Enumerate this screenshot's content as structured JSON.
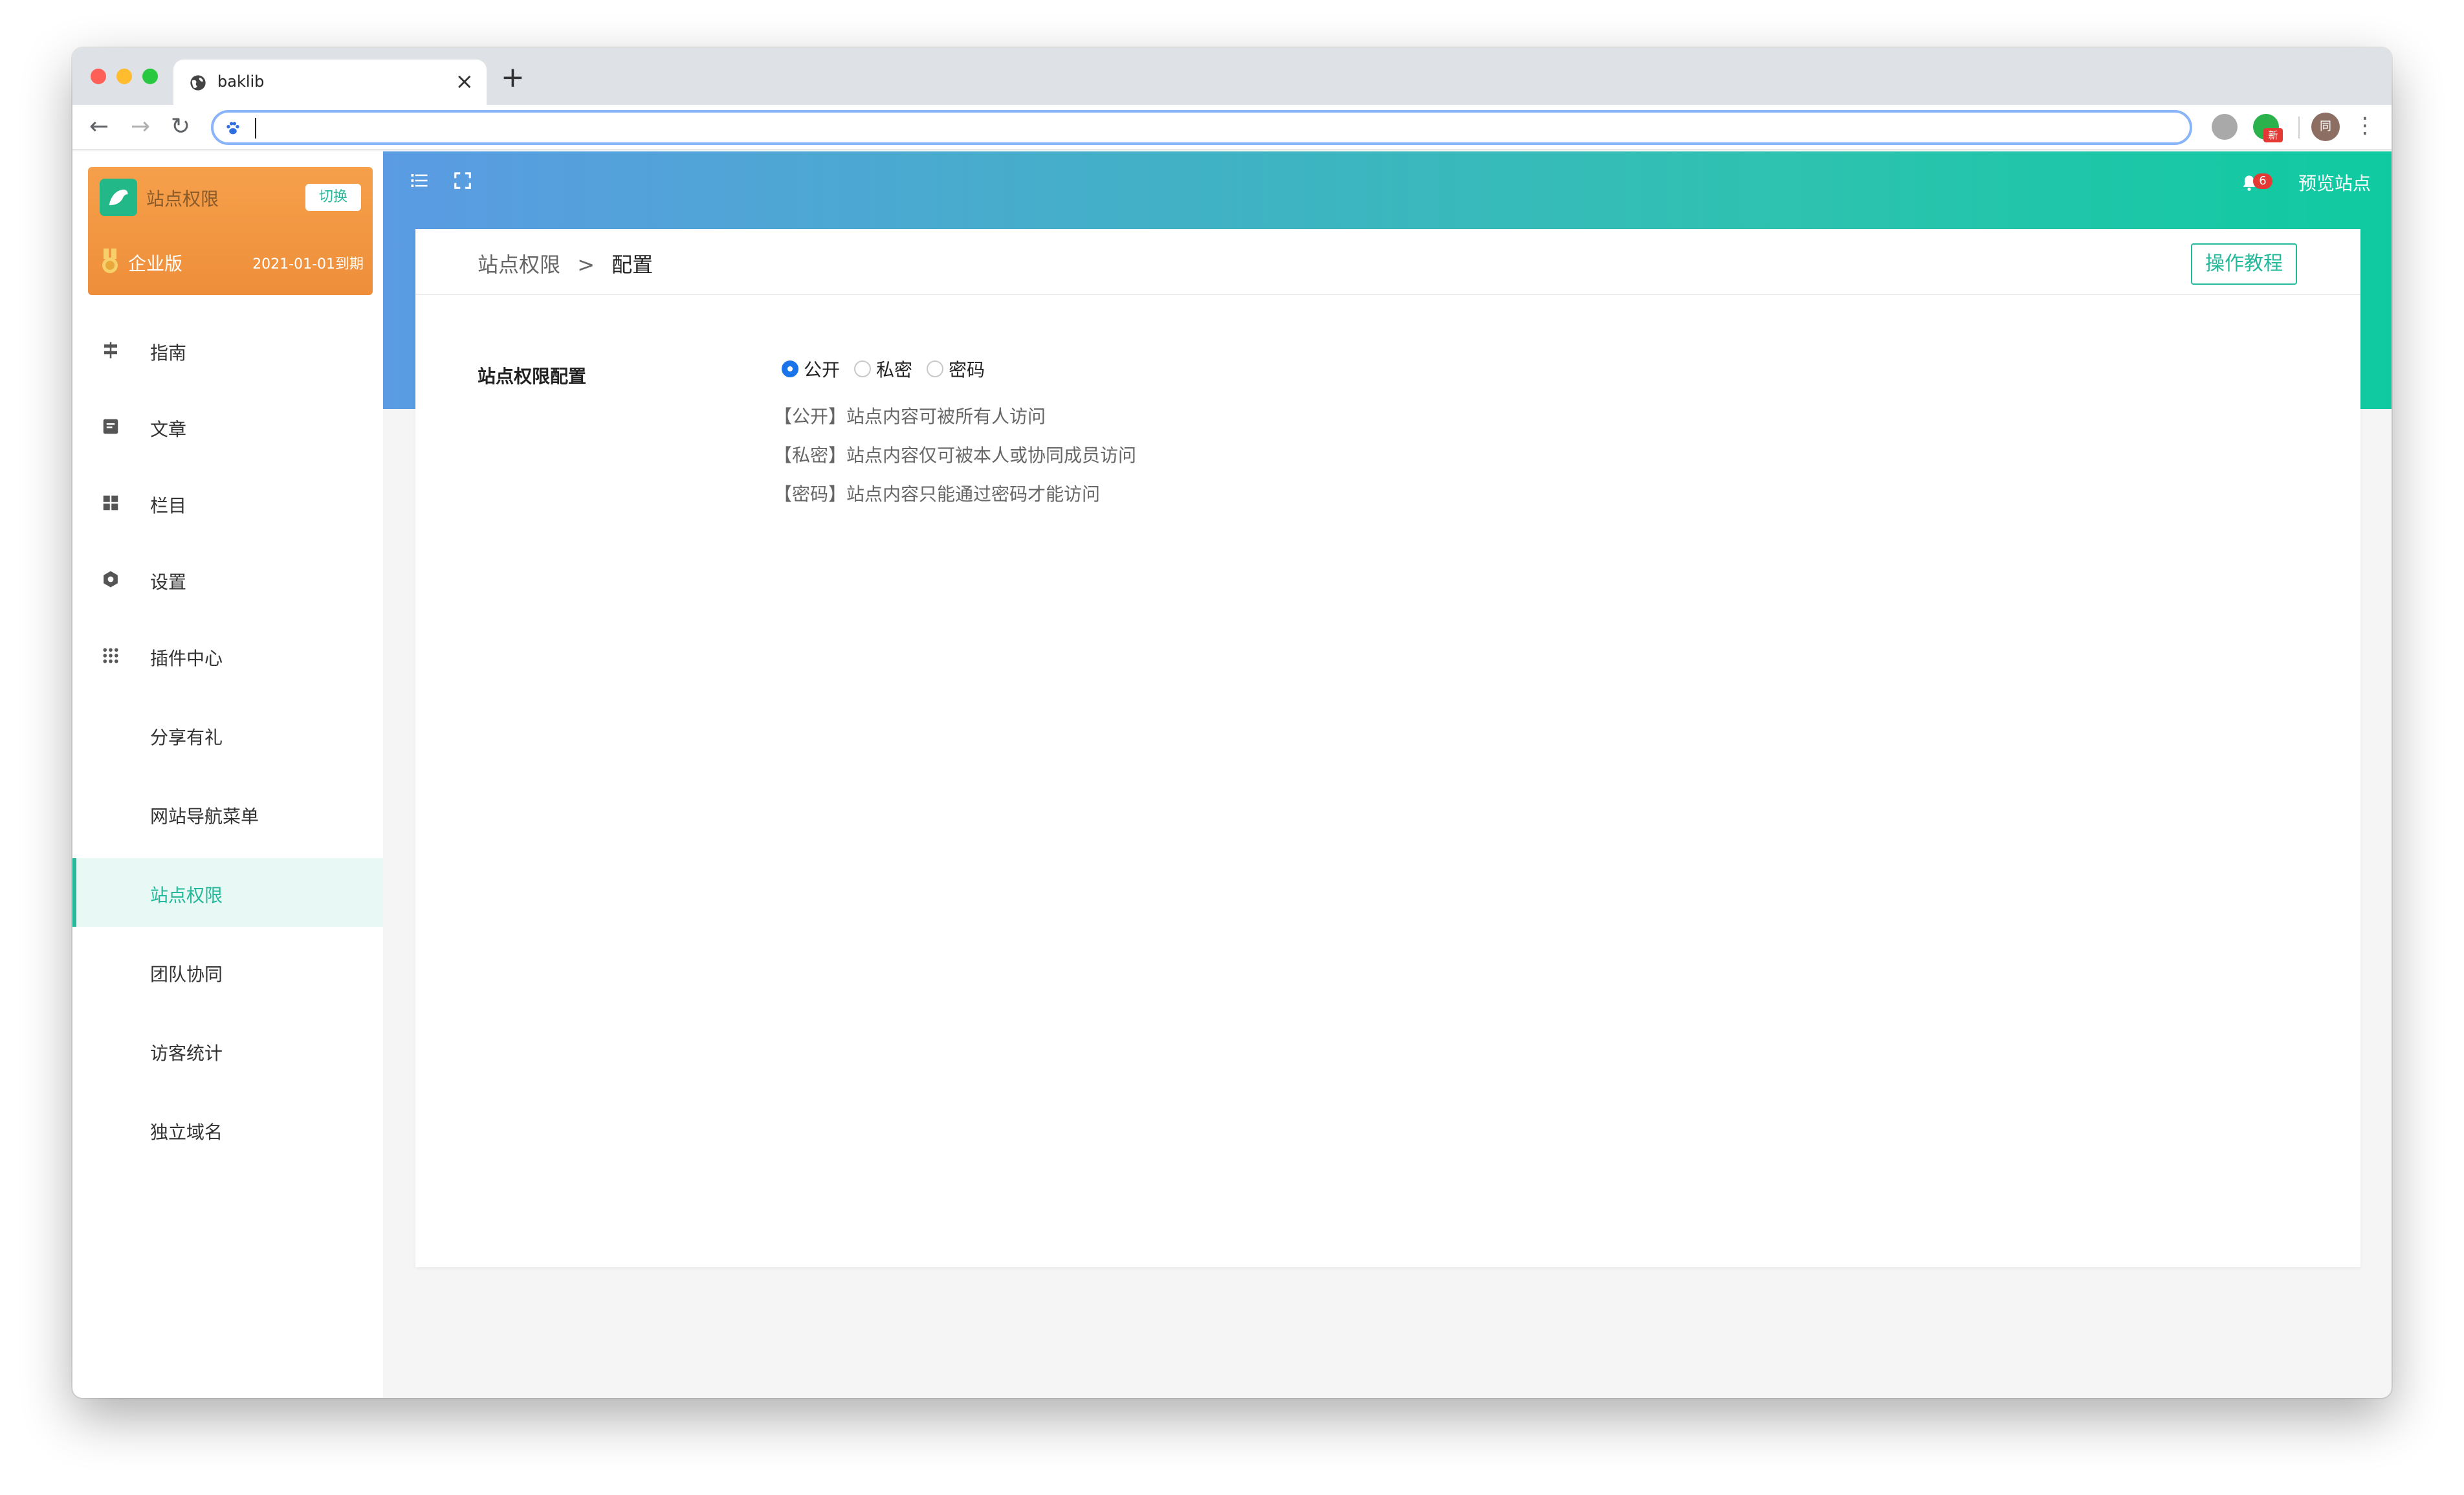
{
  "browser": {
    "tab_title": "baklib",
    "tab_close": "×",
    "new_tab": "+",
    "url_value": "",
    "back": "←",
    "forward": "→",
    "reload": "↻",
    "menu": "⋮",
    "ext_badge": "新",
    "avatar_initial": "同"
  },
  "sidebar": {
    "site_name": "站点权限",
    "switch_label": "切换",
    "edition": "企业版",
    "expiry": "2021-01-01到期",
    "items": [
      {
        "label": "指南",
        "icon": "signpost-icon"
      },
      {
        "label": "文章",
        "icon": "document-icon"
      },
      {
        "label": "栏目",
        "icon": "grid-icon"
      },
      {
        "label": "设置",
        "icon": "gear-icon"
      },
      {
        "label": "插件中心",
        "icon": "apps-icon"
      },
      {
        "label": "分享有礼",
        "icon": ""
      },
      {
        "label": "网站导航菜单",
        "icon": ""
      },
      {
        "label": "站点权限",
        "icon": "",
        "active": true
      },
      {
        "label": "团队协同",
        "icon": ""
      },
      {
        "label": "访客统计",
        "icon": ""
      },
      {
        "label": "独立域名",
        "icon": ""
      }
    ]
  },
  "header": {
    "notification_count": "6",
    "preview_label": "预览站点"
  },
  "main": {
    "breadcrumb": {
      "parent": "站点权限",
      "separator": ">",
      "current": "配置"
    },
    "tutorial_button": "操作教程",
    "config_label": "站点权限配置",
    "options": [
      {
        "label": "公开",
        "checked": true
      },
      {
        "label": "私密",
        "checked": false
      },
      {
        "label": "密码",
        "checked": false
      }
    ],
    "descriptions": [
      "【公开】站点内容可被所有人访问",
      "【私密】站点内容仅可被本人或协同成员访问",
      "【密码】站点内容只能通过密码才能访问"
    ]
  },
  "colors": {
    "accent": "#24b99a",
    "radio_checked": "#1a73e8",
    "card_orange": "#f39a45",
    "header_gradient_start": "#5b9be3",
    "header_gradient_end": "#0fcaa1"
  }
}
